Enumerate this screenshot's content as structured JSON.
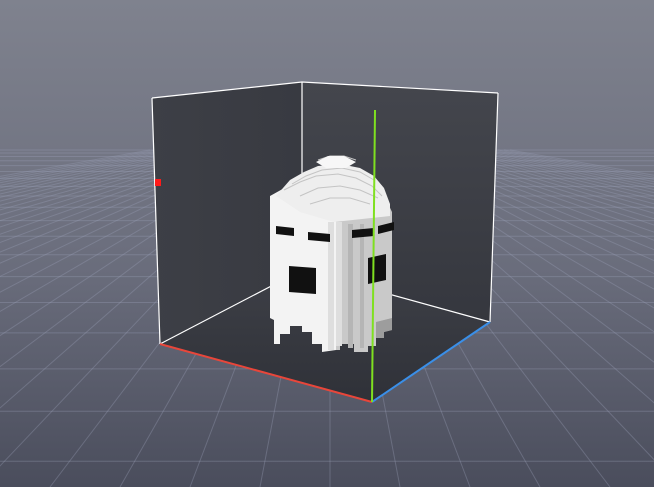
{
  "scene": {
    "model": "ghost-voxel-model",
    "colors": {
      "background_top": "#80838f",
      "background_bottom": "#4a4d5c",
      "grid_line": "#9aa0b8",
      "box_fill": "#3c3e46",
      "box_edge": "#ffffff",
      "axis_x": "#e8463a",
      "axis_y": "#7fe020",
      "axis_z": "#3a8fe8",
      "marker": "#ff1a1a",
      "ghost_body": "#f2f2f2",
      "ghost_shade": "#cfcfcf",
      "ghost_dark": "#a9a9a9",
      "ghost_features": "#111111"
    }
  }
}
